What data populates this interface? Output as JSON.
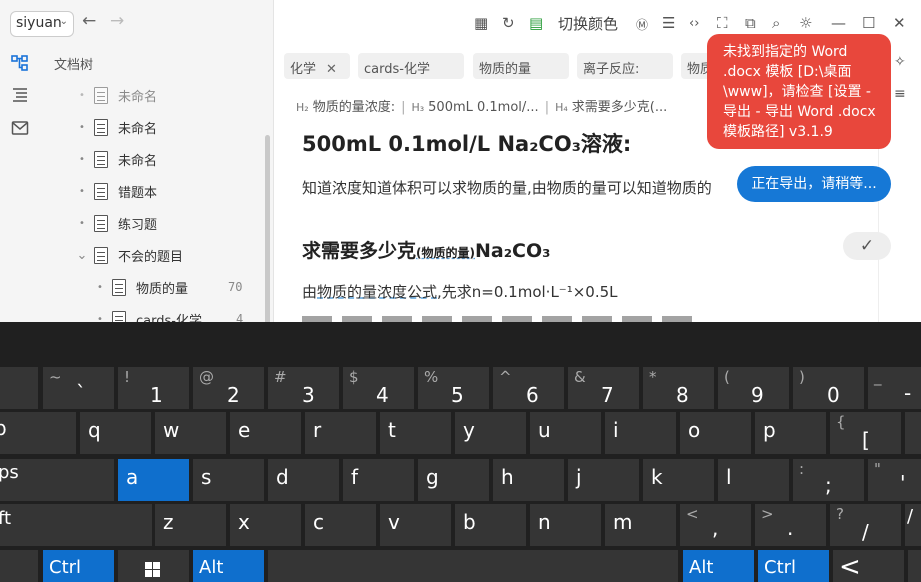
{
  "sidebar": {
    "workspace": "siyuan",
    "tree_title": "文档树",
    "items": [
      {
        "label": "未命名",
        "count": ""
      },
      {
        "label": "未命名",
        "count": ""
      },
      {
        "label": "未命名",
        "count": ""
      },
      {
        "label": "错题本",
        "count": ""
      },
      {
        "label": "练习题",
        "count": ""
      },
      {
        "label": "不会的题目",
        "count": ""
      },
      {
        "label": "物质的量",
        "count": "70"
      },
      {
        "label": "cards-化学",
        "count": "4"
      }
    ]
  },
  "toolbar": {
    "switch_color": "切换颜色"
  },
  "tags": [
    "化学",
    "cards-化学",
    "物质的量",
    "离子反应:",
    "物质"
  ],
  "breadcrumb": [
    {
      "level": "H₂",
      "text": "物质的量浓度:"
    },
    {
      "level": "H₃",
      "text": "500mL 0.1mol/..."
    },
    {
      "level": "H₄",
      "text": "求需要多少克(..."
    }
  ],
  "document": {
    "h3": "500mL 0.1mol/L Na₂CO₃溶液:",
    "p1": "知道浓度知道体积可以求物质的量,由物质的量可以知道物质的",
    "h4_main": "求需要多少克",
    "h4_sub": "(物质的量)",
    "h4_tail": "Na₂CO₃",
    "p2_pre": "由",
    "p2_ul": "物质的量浓度公式",
    "p2_post": ",先求n=0.1mol·L⁻¹×0.5L"
  },
  "notifications": {
    "error": "未找到指定的 Word .docx 模板 [D:\\桌面\\www]，请检查 [设置 - 导出 - 导出 Word .docx 模板路径] v3.1.9",
    "info": "正在导出，请稍等..."
  },
  "colors": {
    "error_bg": "#e8473c",
    "info_bg": "#1678d6",
    "active_key": "#0f6fcd"
  },
  "keyboard": {
    "row1": [
      {
        "shift": "~",
        "main": "`"
      },
      {
        "shift": "!",
        "main": "1"
      },
      {
        "shift": "@",
        "main": "2"
      },
      {
        "shift": "#",
        "main": "3"
      },
      {
        "shift": "$",
        "main": "4"
      },
      {
        "shift": "%",
        "main": "5"
      },
      {
        "shift": "^",
        "main": "6"
      },
      {
        "shift": "&",
        "main": "7"
      },
      {
        "shift": "*",
        "main": "8"
      },
      {
        "shift": "(",
        "main": "9"
      },
      {
        "shift": ")",
        "main": "0"
      },
      {
        "shift": "_",
        "main": "-"
      }
    ],
    "row2": [
      "p",
      "q",
      "w",
      "e",
      "r",
      "t",
      "y",
      "u",
      "i",
      "o",
      "p",
      "{|["
    ],
    "row3": [
      "ps",
      "a",
      "s",
      "d",
      "f",
      "g",
      "h",
      "j",
      "k",
      "l",
      ":|;",
      "\"|'"
    ],
    "row4": [
      "ft",
      "z",
      "x",
      "c",
      "v",
      "b",
      "n",
      "m",
      "<|,",
      ">|.",
      "?|/",
      "/"
    ],
    "row5": [
      "Ctrl",
      "Alt",
      "Alt",
      "Ctrl",
      "<"
    ]
  }
}
